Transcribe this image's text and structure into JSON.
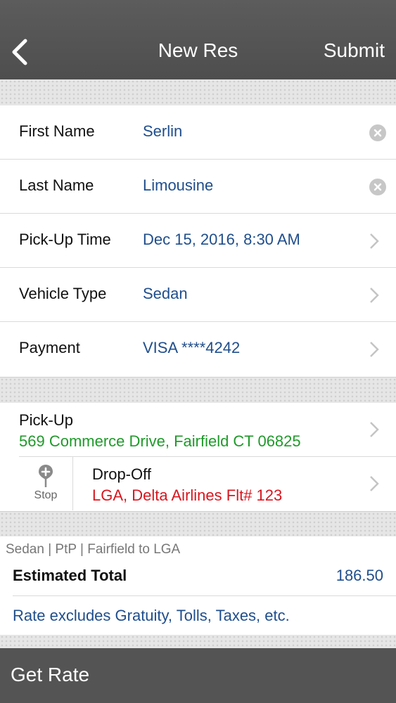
{
  "nav": {
    "title": "New Res",
    "submit_label": "Submit"
  },
  "form": {
    "rows": [
      {
        "label": "First Name",
        "value": "Serlin",
        "accessory": "clear-icon"
      },
      {
        "label": "Last Name",
        "value": "Limousine",
        "accessory": "clear-icon"
      },
      {
        "label": "Pick-Up Time",
        "value": "Dec 15, 2016, 8:30 AM",
        "accessory": "chevron-right-icon"
      },
      {
        "label": "Vehicle Type",
        "value": "Sedan",
        "accessory": "chevron-right-icon"
      },
      {
        "label": "Payment",
        "value": "VISA ****4242",
        "accessory": "chevron-right-icon"
      }
    ]
  },
  "route": {
    "pickup": {
      "title": "Pick-Up",
      "address": "569 Commerce Drive, Fairfield CT 06825"
    },
    "stop_label": "Stop",
    "dropoff": {
      "title": "Drop-Off",
      "address": "LGA, Delta Airlines Flt# 123"
    }
  },
  "summary": {
    "meta": "Sedan | PtP | Fairfield to LGA",
    "estimated_label": "Estimated Total",
    "estimated_value": "186.50",
    "note": "Rate excludes Gratuity, Tolls, Taxes, etc."
  },
  "bottom": {
    "get_rate_label": "Get Rate"
  },
  "colors": {
    "value_blue": "#1f4e8c",
    "pickup_green": "#1f9a2a",
    "dropoff_red": "#d8161f",
    "navbar": "#555555"
  }
}
